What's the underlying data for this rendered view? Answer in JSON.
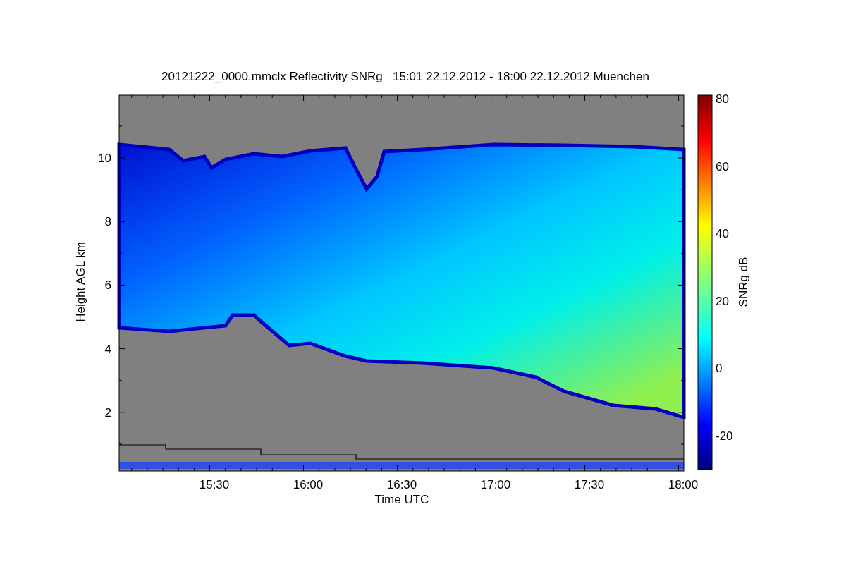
{
  "plot": {
    "title": "20121222_0000.mmclx Reflectivity SNRg   15:01 22.12.2012 - 18:00 22.12.2012 Muenchen",
    "ylabel": "Height AGL km",
    "yticks": [
      "10",
      "8",
      "6",
      "4",
      "2"
    ],
    "xlabel": "Time UTC",
    "xticks": [
      "15:30",
      "16:00",
      "16:30",
      "17:00",
      "17:30",
      "18:00"
    ]
  },
  "colorbar": {
    "label": "SNRg dB",
    "ticks": [
      "80",
      "60",
      "40",
      "20",
      "0",
      "-20"
    ]
  }
}
